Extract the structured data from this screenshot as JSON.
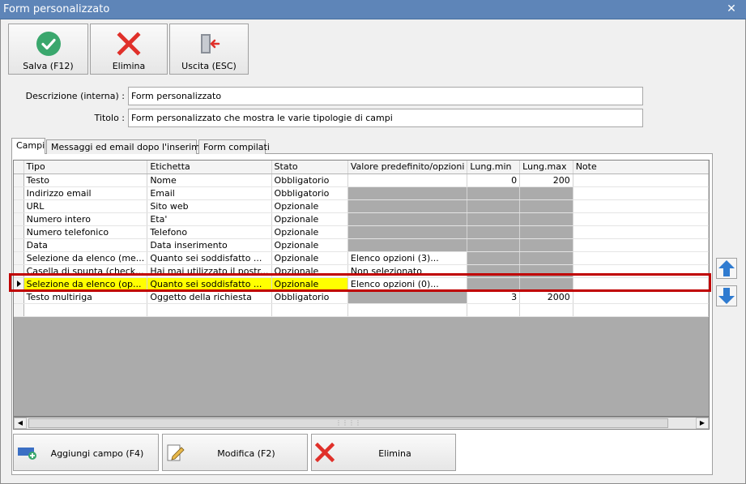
{
  "window": {
    "title": "Form personalizzato"
  },
  "toolbar": {
    "save_label": "Salva (F12)",
    "delete_label": "Elimina",
    "exit_label": "Uscita (ESC)"
  },
  "form": {
    "description_label": "Descrizione (interna) :",
    "description_value": "Form personalizzato",
    "title_label": "Titolo :",
    "title_value": "Form personalizzato che mostra le varie tipologie di campi"
  },
  "tabs": [
    {
      "label": "Campi"
    },
    {
      "label": "Messaggi ed email dopo l'inserimento"
    },
    {
      "label": "Form compilati"
    }
  ],
  "grid": {
    "columns": [
      "Tipo",
      "Etichetta",
      "Stato",
      "Valore predefinito/opzioni",
      "Lung.min",
      "Lung.max",
      "Note"
    ],
    "rows": [
      [
        "Testo",
        "Nome",
        "Obbligatorio",
        "",
        "0",
        "200",
        ""
      ],
      [
        "Indirizzo email",
        "Email",
        "Obbligatorio",
        "",
        "",
        "",
        ""
      ],
      [
        "URL",
        "Sito web",
        "Opzionale",
        "",
        "",
        "",
        ""
      ],
      [
        "Numero intero",
        "Eta'",
        "Opzionale",
        "",
        "",
        "",
        ""
      ],
      [
        "Numero telefonico",
        "Telefono",
        "Opzionale",
        "",
        "",
        "",
        ""
      ],
      [
        "Data",
        "Data inserimento",
        "Opzionale",
        "",
        "",
        "",
        ""
      ],
      [
        "Selezione da elenco (me...",
        "Quanto sei soddisfatto ...",
        "Opzionale",
        "Elenco opzioni (3)...",
        "",
        "",
        ""
      ],
      [
        "Casella di spunta (check...",
        "Hai mai utilizzato il postr...",
        "Opzionale",
        "Non selezionato",
        "",
        "",
        ""
      ],
      [
        "Selezione da elenco (op...",
        "Quanto sei soddisfatto ...",
        "Opzionale",
        "Elenco opzioni (0)...",
        "",
        "",
        ""
      ],
      [
        "Testo multiriga",
        "Oggetto della richiesta",
        "Obbligatorio",
        "",
        "3",
        "2000",
        ""
      ],
      [
        "",
        "",
        "",
        "",
        "",
        "",
        ""
      ]
    ]
  },
  "bottom": {
    "add_label": "Aggiungi campo (F4)",
    "edit_label": "Modifica (F2)",
    "delete_label": "Elimina"
  },
  "colors": {
    "titlebar": "#5e85b8",
    "selected_row": "#ffff00",
    "highlight_border": "#c00000",
    "disabled_cell": "#ababab"
  }
}
